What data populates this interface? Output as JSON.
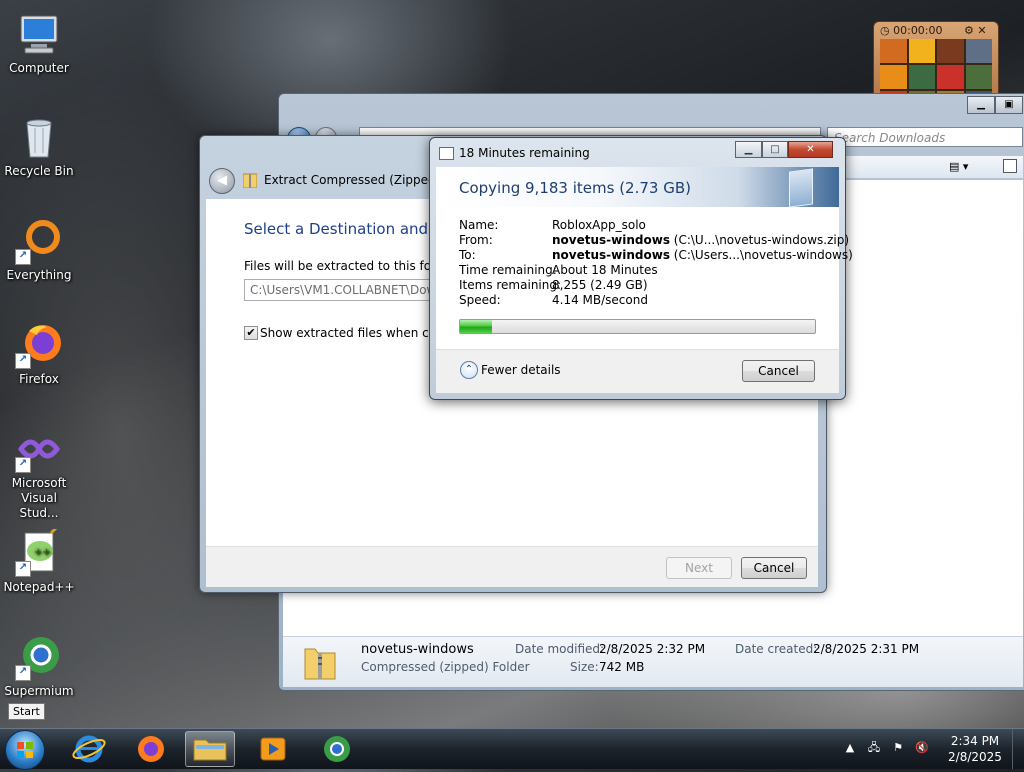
{
  "desktop": {
    "icons": [
      {
        "label": "Computer"
      },
      {
        "label": "Recycle Bin"
      },
      {
        "label": "Everything"
      },
      {
        "label": "Firefox"
      },
      {
        "label": "Microsoft Visual Stud..."
      },
      {
        "label": "Notepad++"
      },
      {
        "label": "Supermium"
      }
    ],
    "start_tooltip": "Start"
  },
  "explorer": {
    "search_placeholder": "Search Downloads",
    "file": {
      "name": "novetus-windows",
      "type": "Compressed (zipped) Folder",
      "date_modified_label": "Date modified:",
      "date_modified": "2/8/2025 2:32 PM",
      "size_label": "Size:",
      "size": "742 MB",
      "date_created_label": "Date created:",
      "date_created": "2/8/2025 2:31 PM"
    }
  },
  "extract_dialog": {
    "title": "Extract Compressed (Zipped) Fo",
    "heading": "Select a Destination and Ex",
    "files_label": "Files will be extracted to this folder:",
    "path": "C:\\Users\\VM1.COLLABNET\\Down",
    "show_files_label": "Show extracted files when comp",
    "show_files_checked": true,
    "next_label": "Next",
    "cancel_label": "Cancel"
  },
  "copy_dialog": {
    "title": "18 Minutes remaining",
    "heading": "Copying 9,183 items (2.73 GB)",
    "rows": [
      {
        "label": "Name:",
        "value": "RobloxApp_solo",
        "value_bold": "",
        "value_rest": ""
      },
      {
        "label": "From:",
        "value": "",
        "value_bold": "novetus-windows",
        "value_rest": " (C:\\U...\\novetus-windows.zip)"
      },
      {
        "label": "To:",
        "value": "",
        "value_bold": "novetus-windows",
        "value_rest": " (C:\\Users...\\novetus-windows)"
      },
      {
        "label": "Time remaining:",
        "value": "About 18 Minutes",
        "value_bold": "",
        "value_rest": ""
      },
      {
        "label": "Items remaining:",
        "value": "8,255 (2.49 GB)",
        "value_bold": "",
        "value_rest": ""
      },
      {
        "label": "Speed:",
        "value": "4.14 MB/second",
        "value_bold": "",
        "value_rest": ""
      }
    ],
    "progress": 0.09,
    "fewer_details_label": "Fewer details",
    "cancel_label": "Cancel"
  },
  "gadget": {
    "timer": "00:00:00"
  },
  "taskbar": {
    "apps": [
      "internet-explorer",
      "firefox",
      "file-explorer",
      "media-player",
      "supermium"
    ],
    "active_app": "file-explorer",
    "time": "2:34 PM",
    "date": "2/8/2025"
  },
  "colors": {
    "accent": "#1e3f8a",
    "progress_green": "#21a51a"
  }
}
